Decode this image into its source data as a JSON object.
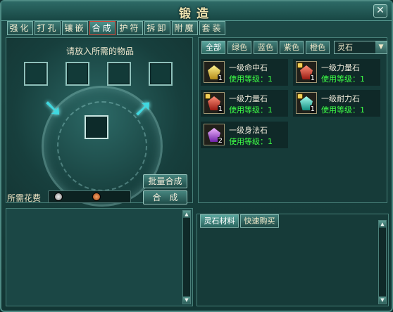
{
  "window": {
    "title": "锻造",
    "close_symbol": "✕"
  },
  "tabs": [
    "强化",
    "打孔",
    "镶嵌",
    "合成",
    "护符",
    "拆卸",
    "附魔",
    "套装"
  ],
  "active_tab_index": 3,
  "compose": {
    "prompt": "请放入所需的物品",
    "batch_button": "批量合成",
    "compose_button": "合　成",
    "cost_label": "所需花费"
  },
  "filters": [
    "全部",
    "绿色",
    "蓝色",
    "紫色",
    "橙色"
  ],
  "category_select": "灵石",
  "items": [
    {
      "name": "一级命中石",
      "level": "使用等级：1",
      "qty": "1",
      "color": "yellow",
      "locked": false
    },
    {
      "name": "一级力量石",
      "level": "使用等级：1",
      "qty": "1",
      "color": "red",
      "locked": true
    },
    {
      "name": "一级力量石",
      "level": "使用等级：1",
      "qty": "1",
      "color": "red",
      "locked": true
    },
    {
      "name": "一级耐力石",
      "level": "使用等级：1",
      "qty": "1",
      "color": "teal",
      "locked": true
    },
    {
      "name": "一级身法石",
      "level": "使用等级：1",
      "qty": "2",
      "color": "purple",
      "locked": false
    }
  ],
  "bottom_tabs": [
    "灵石材料",
    "快速购买"
  ],
  "colors": {
    "level_text": "#3dff46",
    "active_tab_border": "#d34c3e",
    "panel_bg": "#163b39"
  }
}
